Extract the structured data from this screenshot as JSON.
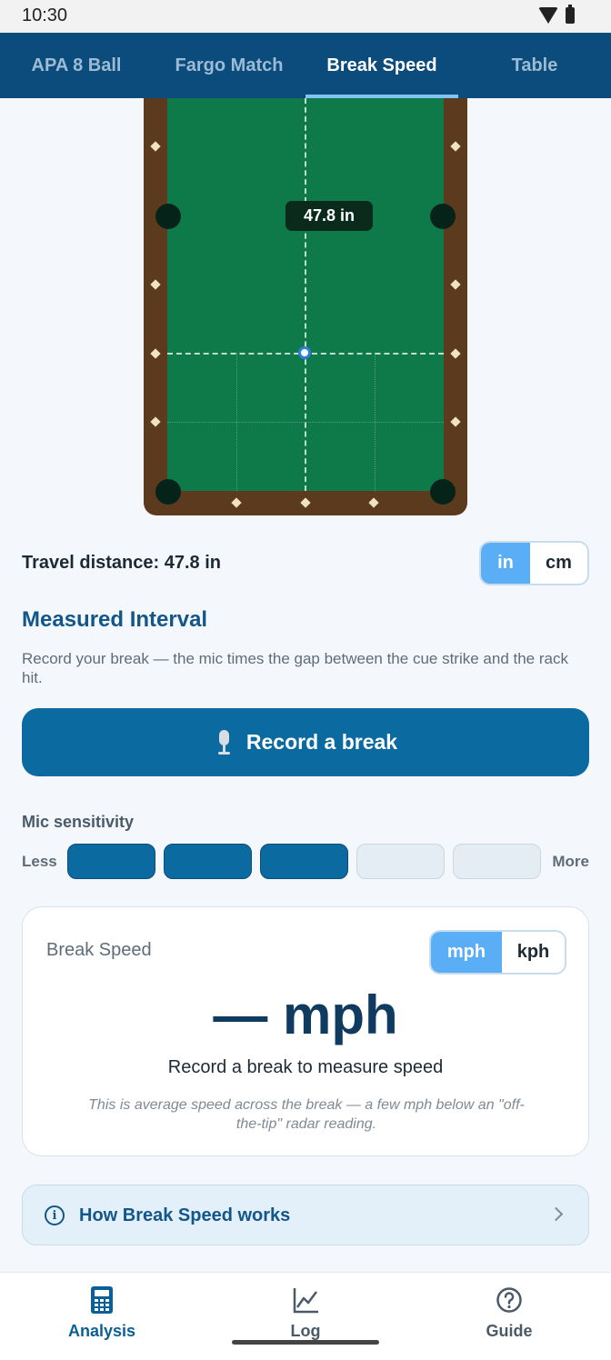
{
  "status": {
    "time": "10:30"
  },
  "tabs": [
    {
      "label": "APA 8 Ball",
      "active": false
    },
    {
      "label": "Fargo Match",
      "active": false
    },
    {
      "label": "Break Speed",
      "active": true
    },
    {
      "label": "Table",
      "active": false
    }
  ],
  "table": {
    "distance_label": "47.8 in"
  },
  "travel": {
    "text": "Travel distance: 47.8 in",
    "units": [
      "in",
      "cm"
    ],
    "selected_unit": "in"
  },
  "interval": {
    "title": "Measured Interval",
    "description": "Record your break — the mic times the gap between the cue strike and the rack hit.",
    "record_label": "Record a break"
  },
  "sensitivity": {
    "title": "Mic sensitivity",
    "less": "Less",
    "more": "More",
    "level": 3,
    "max": 5
  },
  "speed_card": {
    "label": "Break Speed",
    "units": [
      "mph",
      "kph"
    ],
    "selected_unit": "mph",
    "value": "— mph",
    "message": "Record a break to measure speed",
    "note": "This is average speed across the break — a few mph below an \"off-the-tip\" radar reading."
  },
  "howto": {
    "label": "How Break Speed works"
  },
  "nav": [
    {
      "label": "Analysis",
      "icon": "calculator-icon",
      "active": true
    },
    {
      "label": "Log",
      "icon": "chart-line-icon",
      "active": false
    },
    {
      "label": "Guide",
      "icon": "help-circle-icon",
      "active": false
    }
  ],
  "colors": {
    "header": "#0b4c7c",
    "accent": "#0b6aa0",
    "toggle_on": "#5aaef5",
    "felt": "#0e7a4a",
    "rail": "#5b3a1e"
  }
}
